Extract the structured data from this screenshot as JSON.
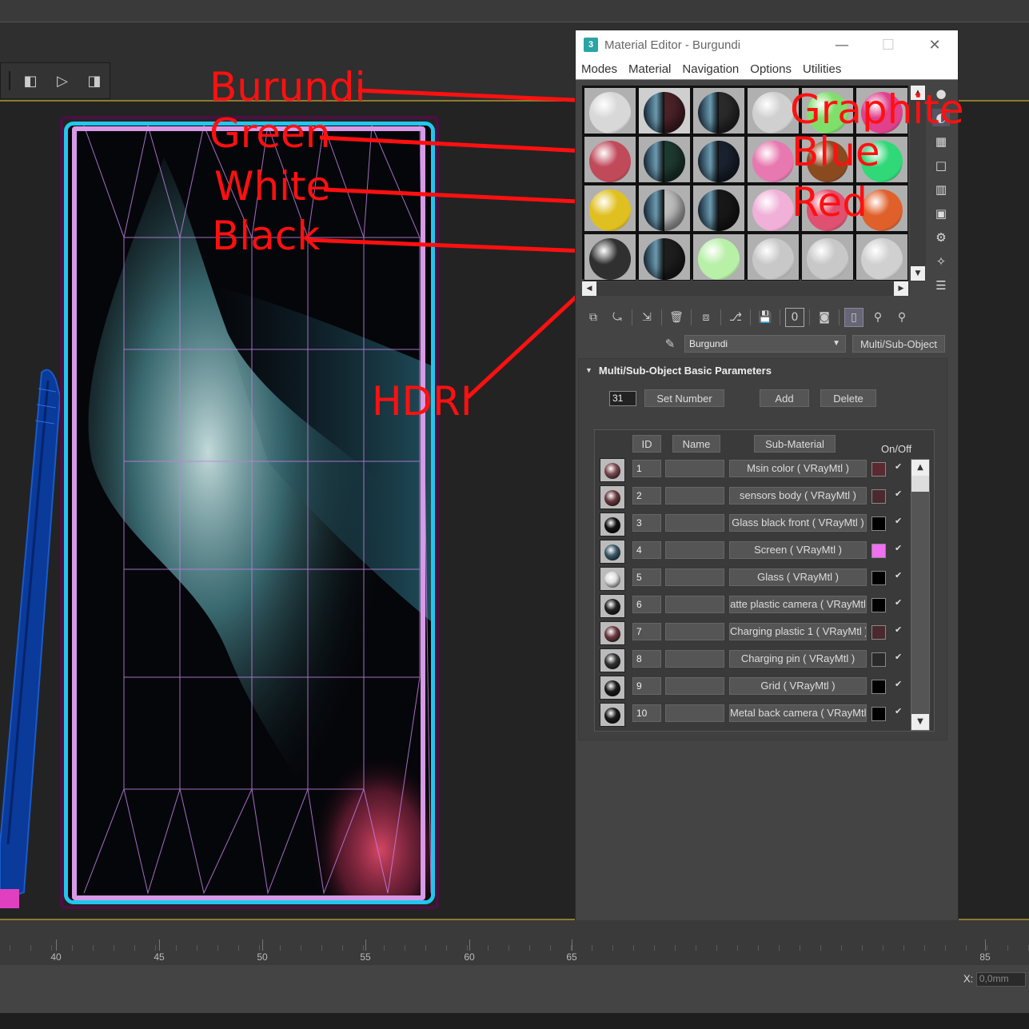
{
  "window": {
    "title": "Material Editor - Burgundi",
    "minimize": "—",
    "maximize": "☐",
    "close": "✕"
  },
  "menu": [
    "Modes",
    "Material",
    "Navigation",
    "Options",
    "Utilities"
  ],
  "annotations": {
    "burundi": "Burundi",
    "green": "Green",
    "white": "White",
    "black": "Black",
    "hdri": "HDRI",
    "graphite": "Graphite",
    "blue": "Blue",
    "red": "Red"
  },
  "material_slots": {
    "rows": [
      [
        "#d8d8d8",
        "split-burgundy",
        "split-graphite",
        "#d0d0d0",
        "#7ee06a",
        "#e0408c"
      ],
      [
        "#c04a5a",
        "split-green",
        "split-blue",
        "#e878b0",
        "#8a4a20",
        "#30d878"
      ],
      [
        "#e0c020",
        "split-white",
        "split-red",
        "#f0b0d8",
        "#e05070",
        "#e0602c"
      ],
      [
        "#303030",
        "split-black",
        "#b8f0a8",
        "#c8c8c8",
        "#c8c8c8",
        "#d0d0d0"
      ]
    ]
  },
  "material_row": {
    "name": "Burgundi",
    "type_button": "Multi/Sub-Object"
  },
  "rollout": {
    "title": "Multi/Sub-Object Basic Parameters",
    "count": "31",
    "set_number": "Set Number",
    "add": "Add",
    "delete": "Delete",
    "col_id": "ID",
    "col_name": "Name",
    "col_sub": "Sub-Material",
    "col_onoff": "On/Off"
  },
  "submaterials": [
    {
      "id": "1",
      "sub": "Msin color  ( VRayMtl )",
      "swatch": "#5a2a30",
      "ball": "#7a4a50"
    },
    {
      "id": "2",
      "sub": "sensors body  ( VRayMtl )",
      "swatch": "#4a2a2e",
      "ball": "#6a3a40"
    },
    {
      "id": "3",
      "sub": "Glass black front  ( VRayMtl )",
      "swatch": "#000000",
      "ball": "#111111"
    },
    {
      "id": "4",
      "sub": "Screen  ( VRayMtl )",
      "swatch": "#f070f0",
      "ball": "#3a5a6a"
    },
    {
      "id": "5",
      "sub": "Glass  ( VRayMtl )",
      "swatch": "#000000",
      "ball": "#dddddd"
    },
    {
      "id": "6",
      "sub": "atte plastic camera  ( VRayMtl",
      "swatch": "#000000",
      "ball": "#222222"
    },
    {
      "id": "7",
      "sub": "Charging plastic 1  ( VRayMtl )",
      "swatch": "#4a2a2e",
      "ball": "#6a3a40"
    },
    {
      "id": "8",
      "sub": "Charging pin  ( VRayMtl )",
      "swatch": "#2a2a2a",
      "ball": "#333333"
    },
    {
      "id": "9",
      "sub": "Grid  ( VRayMtl )",
      "swatch": "#000000",
      "ball": "#1a1a1a"
    },
    {
      "id": "10",
      "sub": "Metal back camera  ( VRayMtl",
      "swatch": "#000000",
      "ball": "#1a1a1a"
    }
  ],
  "timeline": {
    "labels": [
      "40",
      "45",
      "50",
      "55",
      "60",
      "65",
      "85"
    ]
  },
  "status": {
    "x_label": "X:",
    "x_value": "0,0mm"
  },
  "colors": {
    "annotation": "#ff1010",
    "phone_frame": "#22c6ee",
    "phone_inner": "#d69ae6",
    "stylus": "#0a3a9a"
  }
}
